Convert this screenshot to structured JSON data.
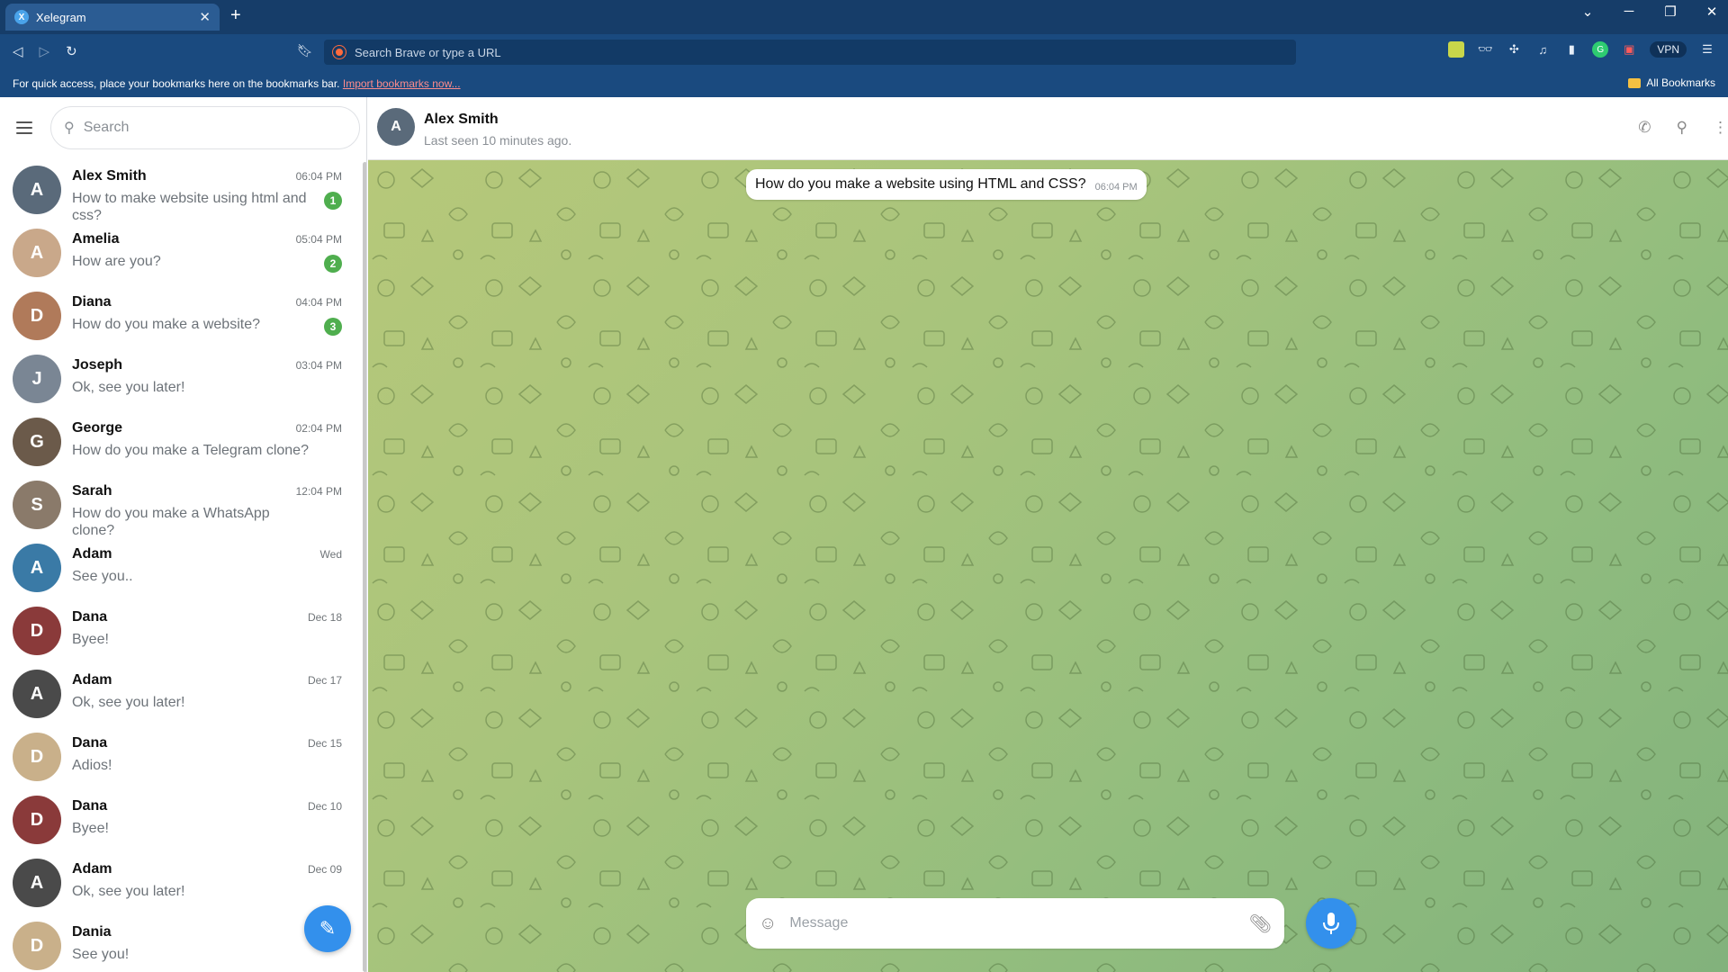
{
  "browser": {
    "tab_title": "Xelegram",
    "tab_favicon": "X",
    "url_placeholder": "Search Brave or type a URL",
    "bookmarks_message": "For quick access, place your bookmarks here on the bookmarks bar.",
    "bookmarks_link": "Import bookmarks now...",
    "all_bookmarks": "All Bookmarks",
    "vpn_label": "VPN"
  },
  "sidebar": {
    "search_placeholder": "Search",
    "chats": [
      {
        "name": "Alex Smith",
        "preview": "How to make website using html and css?",
        "time": "06:04 PM",
        "badge": "1",
        "color": "#5a6a7a",
        "initial": "A"
      },
      {
        "name": "Amelia",
        "preview": "How are you?",
        "time": "05:04 PM",
        "badge": "2",
        "color": "#c9a88a",
        "initial": "A"
      },
      {
        "name": "Diana",
        "preview": "How do you make a website?",
        "time": "04:04 PM",
        "badge": "3",
        "color": "#b07a5a",
        "initial": "D"
      },
      {
        "name": "Joseph",
        "preview": "Ok, see you later!",
        "time": "03:04 PM",
        "badge": "",
        "color": "#7a8694",
        "initial": "J"
      },
      {
        "name": "George",
        "preview": "How do you make a Telegram clone?",
        "time": "02:04 PM",
        "badge": "",
        "color": "#6b5a4a",
        "initial": "G"
      },
      {
        "name": "Sarah",
        "preview": "How do you make a WhatsApp clone?",
        "time": "12:04 PM",
        "badge": "",
        "color": "#8a7a6a",
        "initial": "S"
      },
      {
        "name": "Adam",
        "preview": "See you..",
        "time": "Wed",
        "badge": "",
        "color": "#3a7aa6",
        "initial": "A"
      },
      {
        "name": "Dana",
        "preview": "Byee!",
        "time": "Dec 18",
        "badge": "",
        "color": "#8a3a3a",
        "initial": "D"
      },
      {
        "name": "Adam",
        "preview": "Ok, see you later!",
        "time": "Dec 17",
        "badge": "",
        "color": "#4a4a4a",
        "initial": "A"
      },
      {
        "name": "Dana",
        "preview": "Adios!",
        "time": "Dec 15",
        "badge": "",
        "color": "#c9b08a",
        "initial": "D"
      },
      {
        "name": "Dana",
        "preview": "Byee!",
        "time": "Dec 10",
        "badge": "",
        "color": "#8a3a3a",
        "initial": "D"
      },
      {
        "name": "Adam",
        "preview": "Ok, see you later!",
        "time": "Dec 09",
        "badge": "",
        "color": "#4a4a4a",
        "initial": "A"
      },
      {
        "name": "Dania",
        "preview": "See you!",
        "time": "",
        "badge": "",
        "color": "#c9b08a",
        "initial": "D"
      }
    ]
  },
  "chat": {
    "name": "Alex Smith",
    "status": "Last seen 10 minutes ago.",
    "avatar_color": "#5a6a7a",
    "avatar_initial": "A",
    "message_text": "How do you make a website using HTML and CSS?",
    "message_time": "06:04 PM",
    "composer_placeholder": "Message"
  },
  "colors": {
    "accent": "#3390ec",
    "unread_badge": "#4fae4e",
    "browser_frame": "#1a4a7f"
  }
}
